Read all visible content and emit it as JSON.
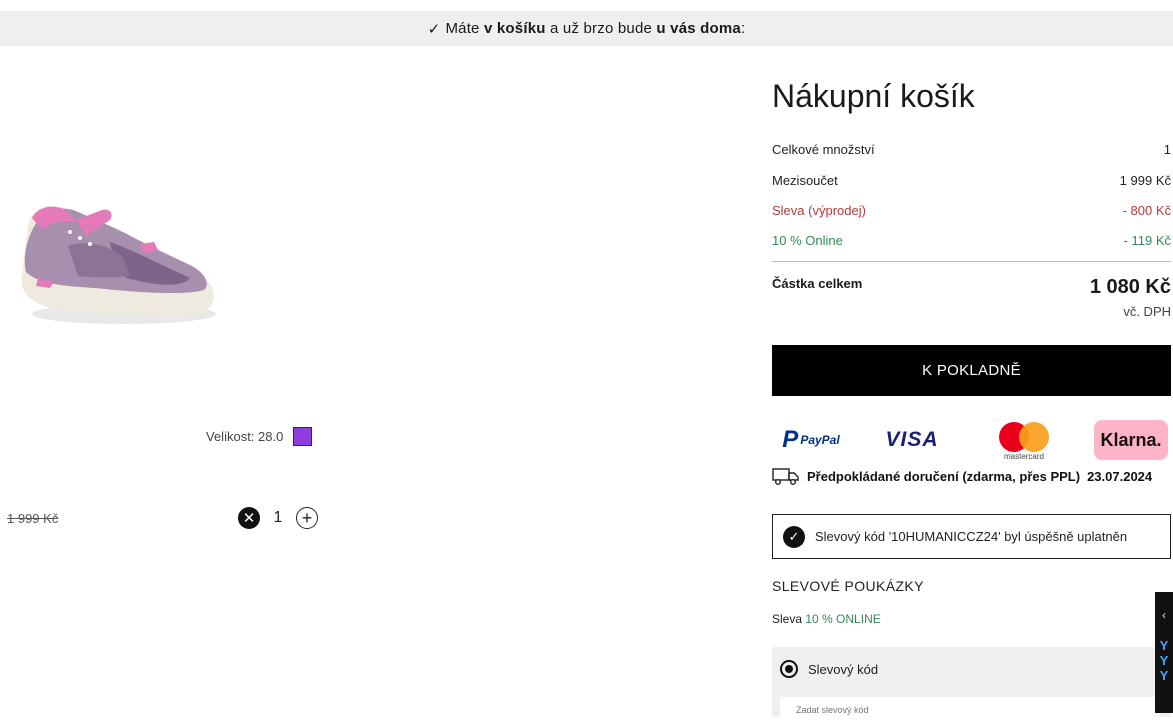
{
  "banner": {
    "check": "✓",
    "part1": "Máte",
    "bold1": "v košíku",
    "part2": "a už brzo bude",
    "bold2": "u vás doma",
    "part3": ":"
  },
  "product": {
    "size_label": "Velikost: 28.0",
    "swatch_color": "#8f3de0",
    "old_price": "1 999 Kč",
    "quantity": "1",
    "remove_icon": "✕",
    "add_icon": "+"
  },
  "cart": {
    "title": "Nákupní košík",
    "rows": [
      {
        "label": "Celkové množství",
        "value": "1"
      },
      {
        "label": "Mezisoučet",
        "value": "1 999 Kč"
      },
      {
        "label": "Sleva (výprodej)",
        "value": "- 800 Kč"
      },
      {
        "label": "10 % Online",
        "value": "- 119 Kč"
      }
    ],
    "total_label": "Částka celkem",
    "total_value": "1 080 Kč",
    "vat_note": "vč. DPH",
    "checkout_label": "K POKLADNĚ"
  },
  "payments": {
    "paypal": "PayPal",
    "paypal_mark": "P",
    "visa": "VISA",
    "mastercard": "mastercard",
    "klarna": "Klarna."
  },
  "delivery": {
    "text": "Předpokládané doručení (zdarma, přes PPL)",
    "date": "23.07.2024"
  },
  "coupon": {
    "success_icon": "✓",
    "success_message": "Slevový kód '10HUMANICCZ24' byl úspěšně uplatněn",
    "vouchers_title": "SLEVOVÉ POUKÁZKY",
    "discount_prefix": "Sleva",
    "discount_name": "10 % ONLINE",
    "radio_label": "Slevový kód",
    "input_placeholder": "Zadat slevový kód"
  },
  "side_tab": {
    "chevron": "‹",
    "letters": "Y\nY\nY"
  },
  "colors": {
    "discount_red": "#b53a3a",
    "online_green": "#2f8a56",
    "checkout_bg": "#000000"
  }
}
